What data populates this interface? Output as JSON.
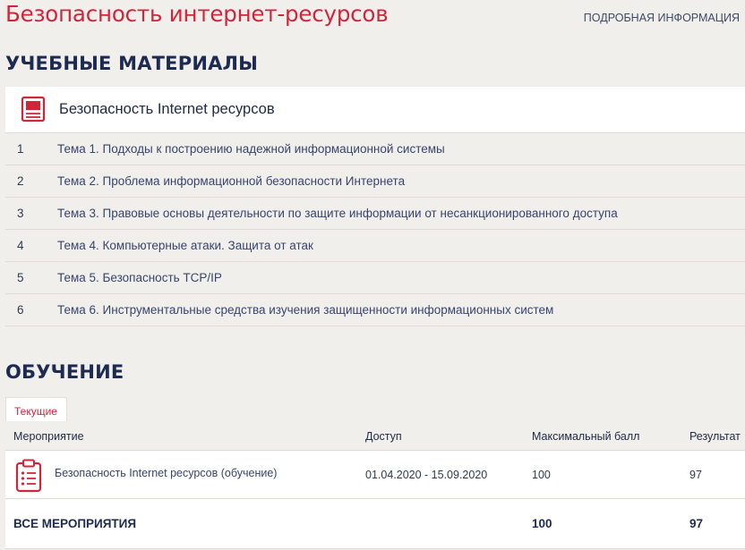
{
  "header": {
    "course_title": "Безопасность интернет-ресурсов",
    "more_link": "ПОДРОБНАЯ ИНФОРМАЦИЯ"
  },
  "materials": {
    "heading": "УЧЕБНЫЕ МАТЕРИАЛЫ",
    "title": "Безопасность Internet ресурсов",
    "topics": [
      {
        "num": "1",
        "label": "Тема 1. Подходы к построению надежной информационной системы"
      },
      {
        "num": "2",
        "label": "Тема 2. Проблема информационной безопасности Интернета"
      },
      {
        "num": "3",
        "label": "Тема 3. Правовые основы деятельности по защите информации от несанкционированного доступа"
      },
      {
        "num": "4",
        "label": "Тема 4. Компьютерные атаки. Защита от атак"
      },
      {
        "num": "5",
        "label": "Тема 5. Безопасность TCP/IP"
      },
      {
        "num": "6",
        "label": "Тема 6. Инструментальные средства изучения защищенности информационных систем"
      }
    ]
  },
  "learning": {
    "heading": "ОБУЧЕНИЕ",
    "tab_label": "Текущие",
    "columns": {
      "event": "Мероприятие",
      "access": "Доступ",
      "max_score": "Максимальный балл",
      "result": "Результат"
    },
    "event": {
      "name": "Безопасность Internet ресурсов (обучение)",
      "access": "01.04.2020 - 15.09.2020",
      "max_score": "100",
      "result": "97"
    },
    "total": {
      "label": "ВСЕ МЕРОПРИЯТИЯ",
      "max_score": "100",
      "result": "97"
    }
  },
  "colors": {
    "accent": "#d4243a",
    "heading": "#1d2a52",
    "background": "#f1efec"
  },
  "icons": {
    "materials": "book-icon",
    "event": "clipboard-list-icon"
  }
}
